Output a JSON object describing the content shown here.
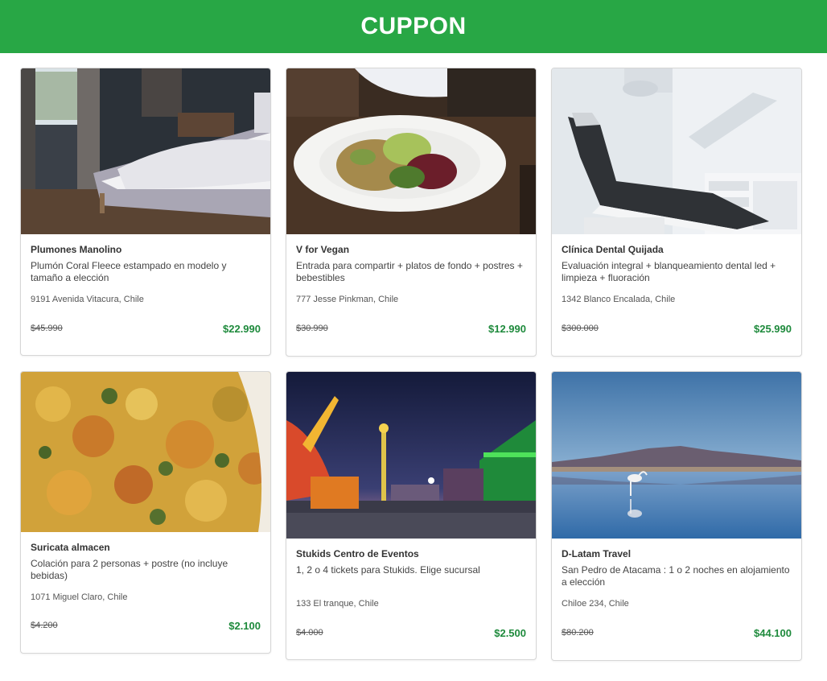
{
  "header": {
    "brand": "CUPPON",
    "color": "#28a745"
  },
  "cards": [
    {
      "image": "bedroom-photo",
      "title": "Plumones Manolino",
      "description": "Plumón Coral Fleece estampado en modelo y tamaño a elección",
      "address": "9191 Avenida Vitacura, Chile",
      "old_price": "$45.990",
      "new_price": "$22.990"
    },
    {
      "image": "vegan-salad-photo",
      "title": "V for Vegan",
      "description": "Entrada para compartir + platos de fondo + postres + bebestibles",
      "address": "777 Jesse Pinkman, Chile",
      "old_price": "$30.990",
      "new_price": "$12.990"
    },
    {
      "image": "dental-chair-photo",
      "title": "Clínica Dental Quijada",
      "description": "Evaluación integral + blanqueamiento dental led + limpieza + fluoración",
      "address": "1342 Blanco Encalada, Chile",
      "old_price": "$300.000",
      "new_price": "$25.990"
    },
    {
      "image": "food-dish-photo",
      "title": "Suricata almacen",
      "description": "Colación para 2 personas + postre (no incluye bebidas)",
      "address": "1071 Miguel Claro, Chile",
      "old_price": "$4.200",
      "new_price": "$2.100"
    },
    {
      "image": "amusement-park-photo",
      "title": "Stukids Centro de Eventos",
      "description": "1, 2 o 4 tickets para Stukids. Elige sucursal",
      "address": "133 El tranque, Chile",
      "old_price": "$4.000",
      "new_price": "$2.500"
    },
    {
      "image": "flamingo-lake-photo",
      "title": "D-Latam Travel",
      "description": "San Pedro de Atacama : 1 o 2 noches en alojamiento a elección",
      "address": "Chiloe 234, Chile",
      "old_price": "$80.200",
      "new_price": "$44.100"
    }
  ]
}
